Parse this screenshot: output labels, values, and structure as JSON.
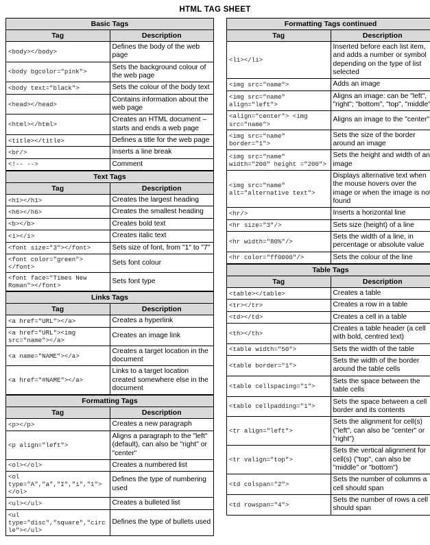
{
  "title": "HTML TAG SHEET",
  "colors": {
    "header_bg": "#d9d9d9",
    "border": "#000000",
    "page_bg": "#ffffff"
  },
  "columns": [
    {
      "name": "left-column",
      "sections": [
        {
          "heading": "Basic Tags",
          "col_headers": [
            "Tag",
            "Description"
          ],
          "rows": [
            {
              "tag": "<body></body>",
              "desc": "Defines the body of the web page"
            },
            {
              "tag": "<body bgcolor=\"pink\">",
              "desc": "Sets the background colour of the web page"
            },
            {
              "tag": "<body text=\"black\">",
              "desc": "Sets the colour of the body text"
            },
            {
              "tag": "<head></head>",
              "desc": "Contains information about the web page"
            },
            {
              "tag": "<html></html>",
              "desc": "Creates an HTML document – starts and ends a web page"
            },
            {
              "tag": "<title></title>",
              "desc": "Defines a title for the web page"
            },
            {
              "tag": "<br/>",
              "desc": "Inserts a line break"
            },
            {
              "tag": "<!-- -->",
              "desc": "Comment"
            }
          ]
        },
        {
          "heading": "Text Tags",
          "col_headers": [
            "Tag",
            "Description"
          ],
          "rows": [
            {
              "tag": "<h1></h1>",
              "desc": "Creates the largest heading"
            },
            {
              "tag": "<h6></h6>",
              "desc": "Creates the smallest heading"
            },
            {
              "tag": "<b></b>",
              "desc": "Creates bold text"
            },
            {
              "tag": "<i></i>",
              "desc": "Creates italic text"
            },
            {
              "tag": "<font size=\"3\"></font>",
              "desc": "Sets size of font, from \"1\" to \"7\""
            },
            {
              "tag": "<font color=\"green\"> </font>",
              "desc": "Sets font colour"
            },
            {
              "tag": "<font face=\"Times New Roman\"></font>",
              "desc": "Sets font type"
            }
          ]
        },
        {
          "heading": "Links Tags",
          "col_headers": [
            "Tag",
            "Description"
          ],
          "rows": [
            {
              "tag": "<a href=\"URL\"></a>",
              "desc": "Creates a hyperlink"
            },
            {
              "tag": "<a href=\"URL\"><img src=\"name\"></a>",
              "desc": "Creates an image link"
            },
            {
              "tag": "<a name=\"NAME\"></a>",
              "desc": "Creates a target location in the document"
            },
            {
              "tag": "<a href=\"#NAME\"></a>",
              "desc": "Links to a target location created somewhere else in the document"
            }
          ]
        },
        {
          "heading": "Formatting Tags",
          "col_headers": [
            "Tag",
            "Description"
          ],
          "rows": [
            {
              "tag": "<p></p>",
              "desc": "Creates a new paragraph"
            },
            {
              "tag": "<p align=\"left\">",
              "desc": "Aligns a paragraph to the \"left\" (default), can also be \"right\" or \"center\""
            },
            {
              "tag": "<ol></ol>",
              "desc": "Creates a numbered list"
            },
            {
              "tag": "<ol type=\"A\",\"a\",\"I\",\"i\",\"1\"></ol>",
              "desc": "Defines the type of numbering used"
            },
            {
              "tag": "<ul></ul>",
              "desc": "Creates a bulleted list"
            },
            {
              "tag": "<ul type=\"disc\",\"square\",\"circle\"></ul>",
              "desc": "Defines the type of bullets used"
            }
          ]
        }
      ]
    },
    {
      "name": "right-column",
      "sections": [
        {
          "heading": "Formatting Tags continued",
          "col_headers": [
            "Tag",
            "Description"
          ],
          "rows": [
            {
              "tag": "<li></li>",
              "desc": "Inserted before each list item, and adds a number or symbol depending on the type of list selected"
            },
            {
              "tag": "<img src=\"name\">",
              "desc": "Adds an image"
            },
            {
              "tag": "<img src=\"name\" align=\"left\">",
              "desc": "Aligns an image: can be \"left\", \"right\"; \"bottom\", \"top\", \"middle\""
            },
            {
              "tag": "<align=\"center\"> <img src=\"name\">",
              "desc": "Aligns an image to the \"center\""
            },
            {
              "tag": "<img src=\"name\" border=\"1\">",
              "desc": "Sets the size of the border around an image"
            },
            {
              "tag": "<img src=\"name\" width=\"200\" height =\"200\">",
              "desc": "Sets the height and width of an image"
            },
            {
              "tag": "<img src=\"name\" alt=\"alternative text\">",
              "desc": "Displays alternative text when the mouse hovers over the image or when the image is not found"
            },
            {
              "tag": "<hr/>",
              "desc": "Inserts a horizontal line"
            },
            {
              "tag": "<hr size=\"3\"/>",
              "desc": "Sets size (height) of a line"
            },
            {
              "tag": "<hr width=\"80%\"/>",
              "desc": "Sets the width of a line, in percentage or absolute value"
            },
            {
              "tag": "<hr color=\"ff0000\"/>",
              "desc": "Sets the colour of the line"
            }
          ]
        },
        {
          "heading": "Table Tags",
          "col_headers": [
            "Tag",
            "Description"
          ],
          "rows": [
            {
              "tag": "<table></table>",
              "desc": "Creates a table"
            },
            {
              "tag": "<tr></tr>",
              "desc": "Creates a row in a table"
            },
            {
              "tag": "<td></td>",
              "desc": "Creates a cell in a table"
            },
            {
              "tag": "<th></th>",
              "desc": "Creates a table header (a cell with bold, centred text)"
            },
            {
              "tag": "<table width=\"50\">",
              "desc": "Sets the width of the table"
            },
            {
              "tag": "<table border=\"1\">",
              "desc": "Sets the width of the border around the table cells"
            },
            {
              "tag": "<table cellspacing=\"1\">",
              "desc": "Sets the space between the table cells"
            },
            {
              "tag": "<table cellpadding=\"1\">",
              "desc": "Sets the space between a cell border and its contents"
            },
            {
              "tag": "<tr align=\"left\">",
              "desc": "Sets the alignment for cell(s) (\"left\", can also be \"center\" or \"right\")"
            },
            {
              "tag": "<tr valign=\"top\">",
              "desc": "Sets the vertical alignment for cell(s) (\"top\", can also be \"middle\" or \"bottom\")"
            },
            {
              "tag": "<td colspan=\"2\">",
              "desc": "Sets the number of columns a cell should span"
            },
            {
              "tag": "<td rowspan=\"4\">",
              "desc": "Sets the number of rows a cell should span"
            }
          ]
        }
      ]
    }
  ]
}
